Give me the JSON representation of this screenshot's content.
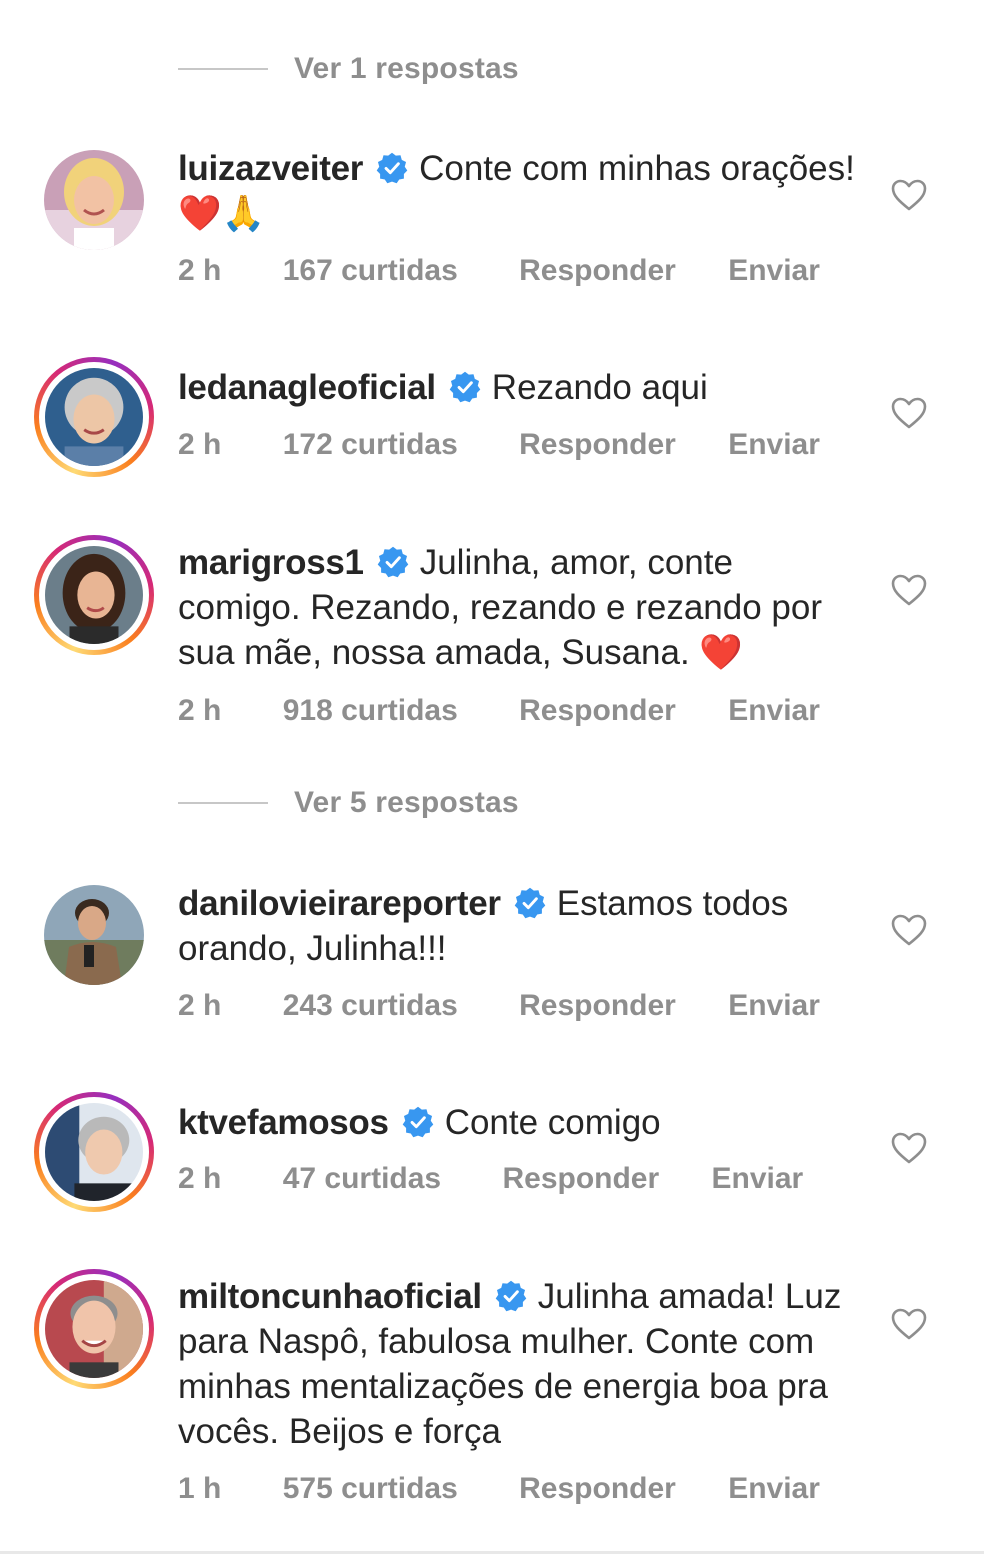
{
  "reply_toggles": [
    {
      "label": "Ver 1 respostas"
    },
    {
      "label": "Ver 5 respostas"
    }
  ],
  "comments": [
    {
      "username": "luizazveiter",
      "text": "Conte com minhas orações! ❤️🙏",
      "time": "2 h",
      "likes": "167 curtidas",
      "reply_label": "Responder",
      "send_label": "Enviar",
      "story_ring": false
    },
    {
      "username": "ledanagleoficial",
      "text": "Rezando aqui",
      "time": "2 h",
      "likes": "172 curtidas",
      "reply_label": "Responder",
      "send_label": "Enviar",
      "story_ring": true
    },
    {
      "username": "marigross1",
      "text": "Julinha, amor, conte comigo. Rezando, rezando e rezando por sua mãe, nossa amada, Susana. ❤️",
      "time": "2 h",
      "likes": "918 curtidas",
      "reply_label": "Responder",
      "send_label": "Enviar",
      "story_ring": true
    },
    {
      "username": "danilovieirareporter",
      "text": "Estamos todos orando, Julinha!!!",
      "time": "2 h",
      "likes": "243 curtidas",
      "reply_label": "Responder",
      "send_label": "Enviar",
      "story_ring": false
    },
    {
      "username": "ktvefamosos",
      "text": "Conte comigo",
      "time": "2 h",
      "likes": "47 curtidas",
      "reply_label": "Responder",
      "send_label": "Enviar",
      "story_ring": true
    },
    {
      "username": "miltoncunhaoficial",
      "text": "Julinha amada! Luz para Naspô, fabulosa mulher. Conte com minhas mentalizações de energia boa pra vocês. Beijos e força",
      "time": "1 h",
      "likes": "575 curtidas",
      "reply_label": "Responder",
      "send_label": "Enviar",
      "story_ring": true
    }
  ],
  "icons": {
    "verified": "verified-badge-icon",
    "like": "heart-outline-icon"
  },
  "colors": {
    "verified_blue": "#3897f0",
    "secondary_text": "#8e8e8e",
    "primary_text": "#262626"
  }
}
